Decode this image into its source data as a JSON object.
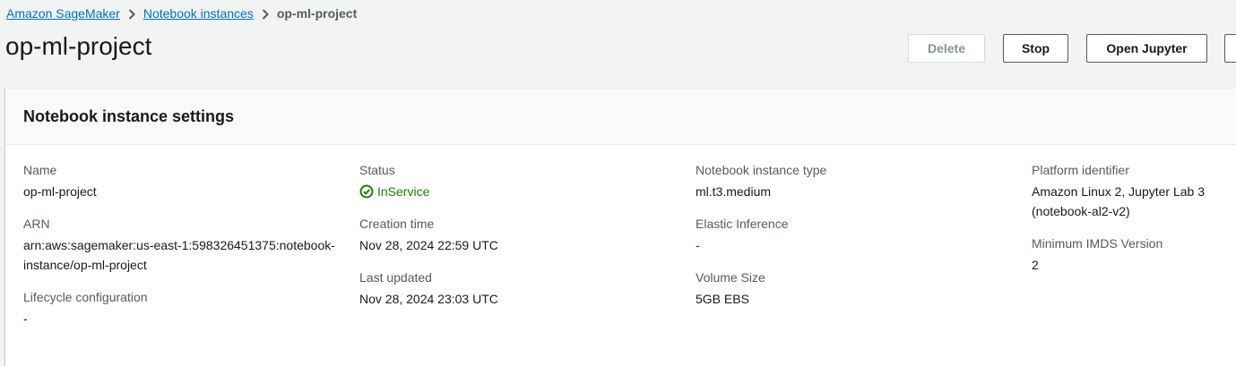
{
  "breadcrumb": {
    "items": [
      "Amazon SageMaker",
      "Notebook instances"
    ],
    "current": "op-ml-project"
  },
  "page": {
    "title": "op-ml-project"
  },
  "actions": {
    "delete_label": "Delete",
    "stop_label": "Stop",
    "open_jupyter_label": "Open Jupyter"
  },
  "panel": {
    "title": "Notebook instance settings"
  },
  "fields": {
    "name": {
      "label": "Name",
      "value": "op-ml-project"
    },
    "arn": {
      "label": "ARN",
      "value_line1": "arn:aws:sagemaker:us-east-1:598326451375:notebook-",
      "value_line2": "instance/op-ml-project"
    },
    "lifecycle": {
      "label": "Lifecycle configuration",
      "value": "-"
    },
    "status": {
      "label": "Status",
      "value": "InService"
    },
    "creation_time": {
      "label": "Creation time",
      "value": "Nov 28, 2024 22:59 UTC"
    },
    "last_updated": {
      "label": "Last updated",
      "value": "Nov 28, 2024 23:03 UTC"
    },
    "instance_type": {
      "label": "Notebook instance type",
      "value": "ml.t3.medium"
    },
    "elastic_inference": {
      "label": "Elastic Inference",
      "value": "-"
    },
    "volume_size": {
      "label": "Volume Size",
      "value": "5GB EBS"
    },
    "platform": {
      "label": "Platform identifier",
      "value_line1": "Amazon Linux 2, Jupyter Lab 3",
      "value_line2": "(notebook-al2-v2)"
    },
    "imds": {
      "label": "Minimum IMDS Version",
      "value": "2"
    }
  },
  "colors": {
    "link": "#0073bb",
    "success": "#1d8102",
    "text": "#16191f",
    "label": "#545b64"
  },
  "icons": {
    "breadcrumb_separator": "chevron-right-icon",
    "status": "status-success-icon"
  }
}
